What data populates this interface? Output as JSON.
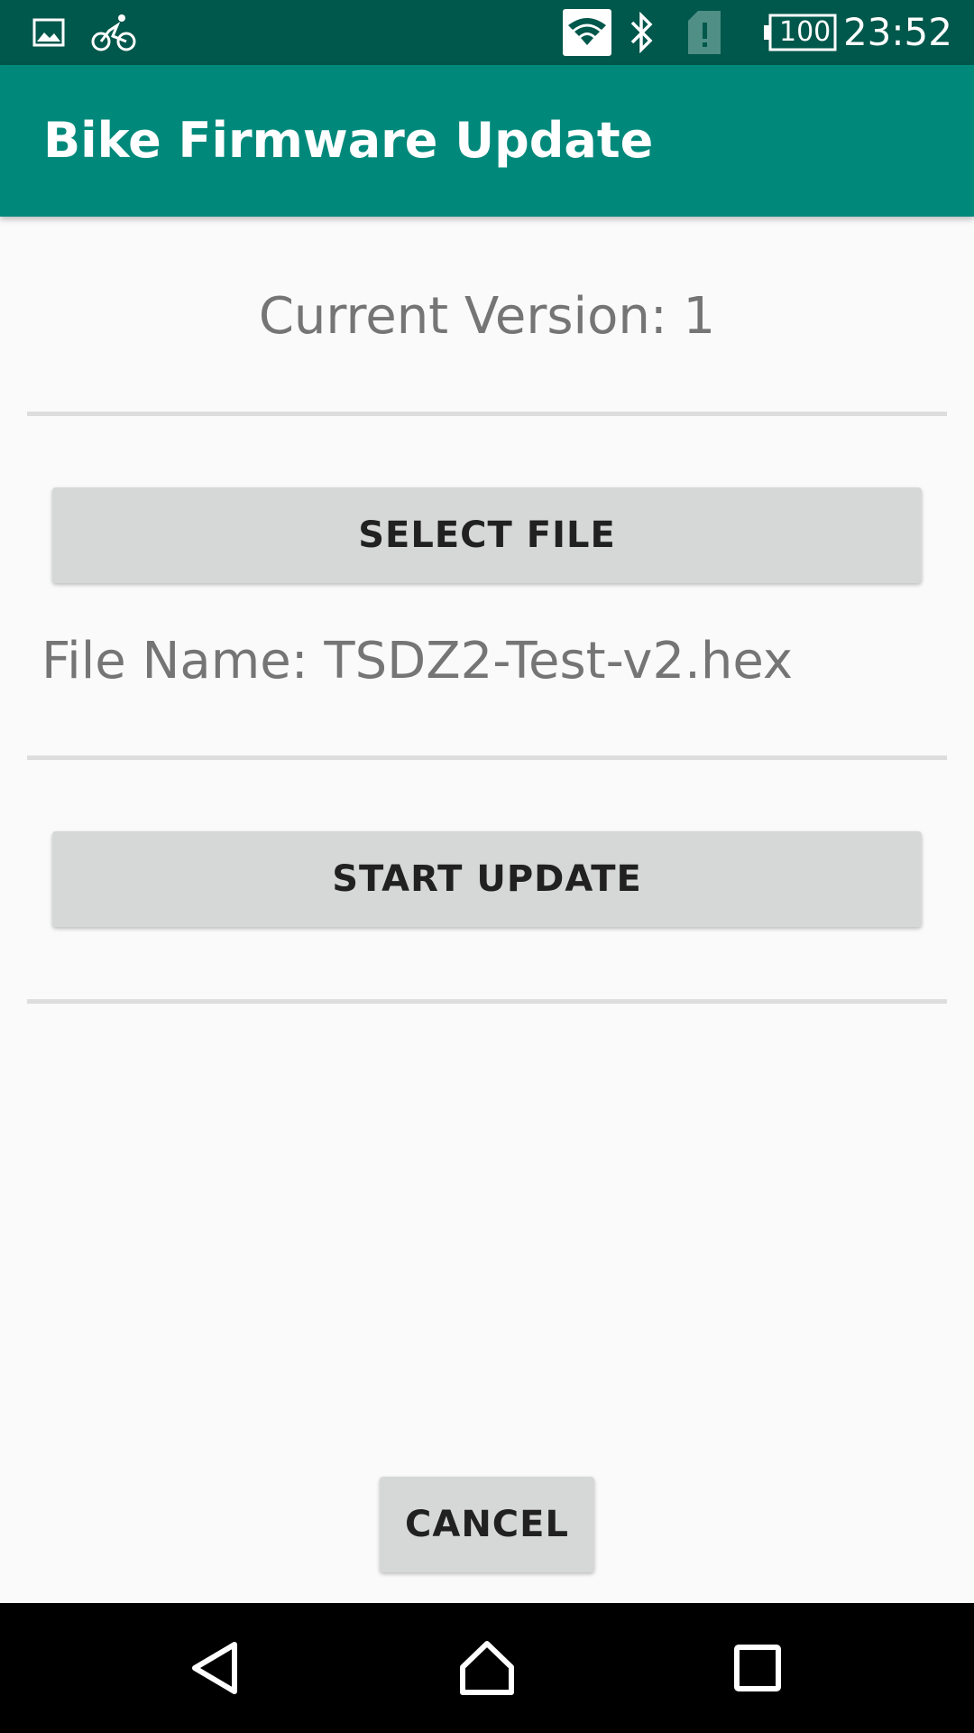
{
  "status_bar": {
    "time": "23:52",
    "battery_level": "100",
    "icons": [
      "image-icon",
      "bike-icon",
      "wifi-icon",
      "bluetooth-icon",
      "sim-alert-icon",
      "battery-icon"
    ]
  },
  "app_bar": {
    "title": "Bike Firmware Update",
    "color": "#00897b"
  },
  "main": {
    "current_version": "Current Version: 1",
    "select_file_label": "SELECT FILE",
    "file_name": "File Name: TSDZ2-Test-v2.hex",
    "start_update_label": "START UPDATE",
    "cancel_label": "CANCEL"
  },
  "nav_bar": {
    "icons": [
      "back-icon",
      "home-icon",
      "recents-icon"
    ]
  }
}
